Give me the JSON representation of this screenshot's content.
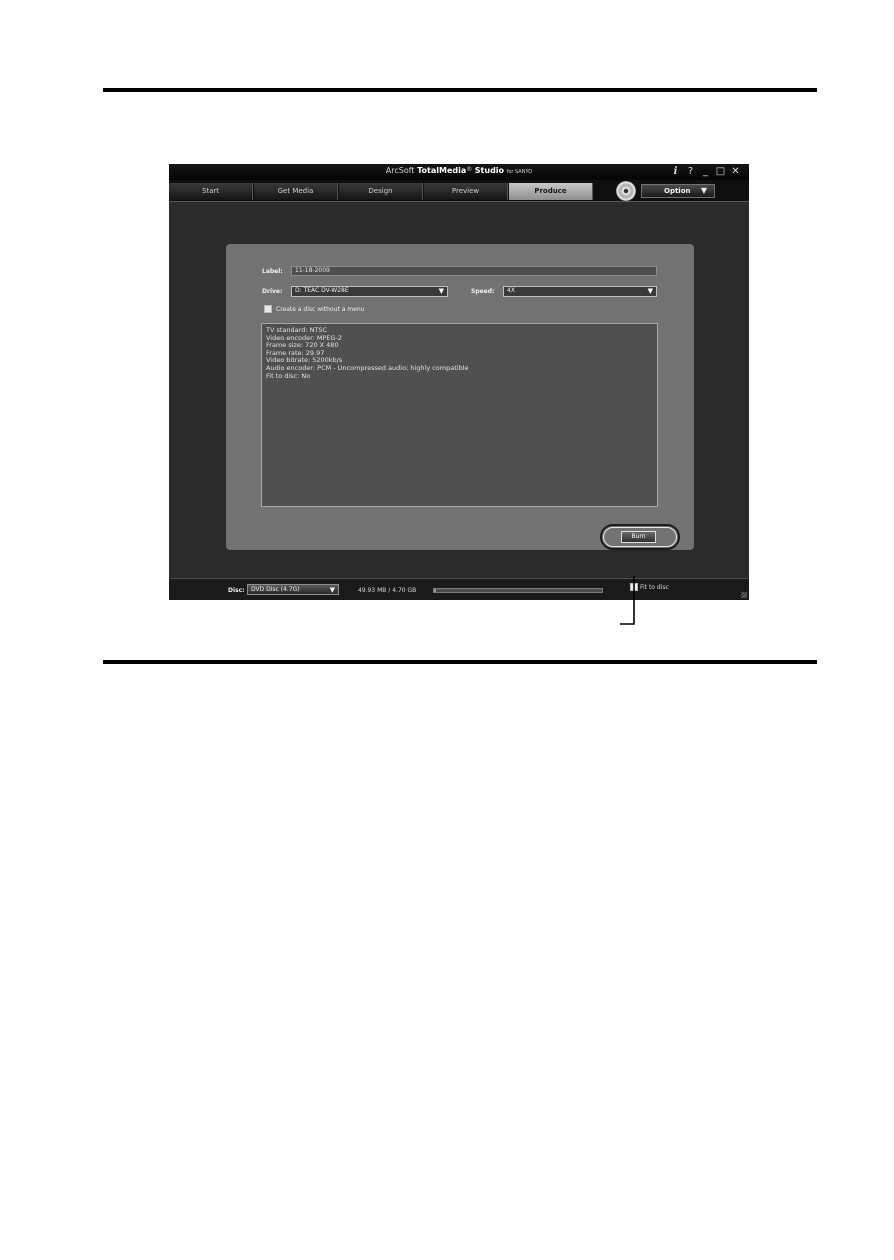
{
  "window": {
    "title_prefix": "ArcSoft",
    "title_product": "TotalMedia",
    "title_tm": "®",
    "title_studio": "Studio",
    "title_for": "for SANYO",
    "btn_info": "i",
    "btn_help": "?",
    "btn_minimize": "_",
    "btn_maximize": "□",
    "btn_close": "✕"
  },
  "tabs": [
    {
      "label": "Start"
    },
    {
      "label": "Get Media"
    },
    {
      "label": "Design"
    },
    {
      "label": "Preview"
    },
    {
      "label": "Produce",
      "active": true
    }
  ],
  "toolbar": {
    "option_label": "Option",
    "option_caret": "▼",
    "disc_icon": "disc-icon"
  },
  "produce": {
    "label_caption": "Label:",
    "label_value": "11-18-2009",
    "drive_caption": "Drive:",
    "drive_value": "D: TEAC DV-W28E",
    "speed_caption": "Speed:",
    "speed_value": "4X",
    "caret": "▼",
    "no_menu_label": "Create a disc without a menu",
    "no_menu_checked": false,
    "info_lines": [
      "TV standard: NTSC",
      "Video encoder: MPEG-2",
      "Frame size: 720 X 480",
      "Frame rate: 29.97",
      "Video bitrate: 5200kb/s",
      "Audio encoder: PCM - Uncompressed audio; highly compatible",
      "Fit to disc: No"
    ],
    "burn_label": "Burn"
  },
  "bottom": {
    "disc_caption": "Disc:",
    "disc_value": "DVD Disc (4.7G)",
    "caret": "▼",
    "size_text": "49.93 MB / 4.70 GB",
    "progress_fraction": 0.01,
    "fit_label": "Fit to disc",
    "fit_checked": false
  },
  "colors": {
    "panel": "#727272",
    "app_bg": "#2b2b2b",
    "active_tab": "#b0b0b0"
  }
}
